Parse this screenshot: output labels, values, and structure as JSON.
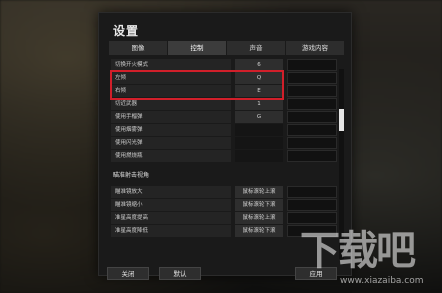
{
  "dialog": {
    "title": "设置",
    "tabs": [
      {
        "label": "图像",
        "active": false
      },
      {
        "label": "控制",
        "active": true
      },
      {
        "label": "声音",
        "active": false
      },
      {
        "label": "游戏内容",
        "active": false
      }
    ]
  },
  "settings": [
    {
      "label": "切换开火模式",
      "value": "6"
    },
    {
      "label": "左倾",
      "value": "Q"
    },
    {
      "label": "右倾",
      "value": "E"
    },
    {
      "label": "切近武器",
      "value": "1"
    },
    {
      "label": "使用手榴弹",
      "value": "G"
    },
    {
      "label": "使用烟雾弹",
      "value": ""
    },
    {
      "label": "使用闪光弹",
      "value": ""
    },
    {
      "label": "使用燃烧瓶",
      "value": ""
    }
  ],
  "section2": {
    "title": "瞄准射击视角",
    "rows": [
      {
        "label": "瞄准镜放大",
        "value": "鼠标滚轮上滚"
      },
      {
        "label": "瞄准镜缩小",
        "value": "鼠标滚轮下滚"
      },
      {
        "label": "准星高度提高",
        "value": "鼠标滚轮上滚"
      },
      {
        "label": "准星高度降低",
        "value": "鼠标滚轮下滚"
      }
    ]
  },
  "buttons": {
    "close": "关闭",
    "default": "默认",
    "apply": "应用"
  },
  "watermark": {
    "main": "下载吧",
    "sub": "www.xiazaiba.com"
  },
  "colors": {
    "highlight": "#d11f2a",
    "active_tab": "#3c3c3c"
  }
}
